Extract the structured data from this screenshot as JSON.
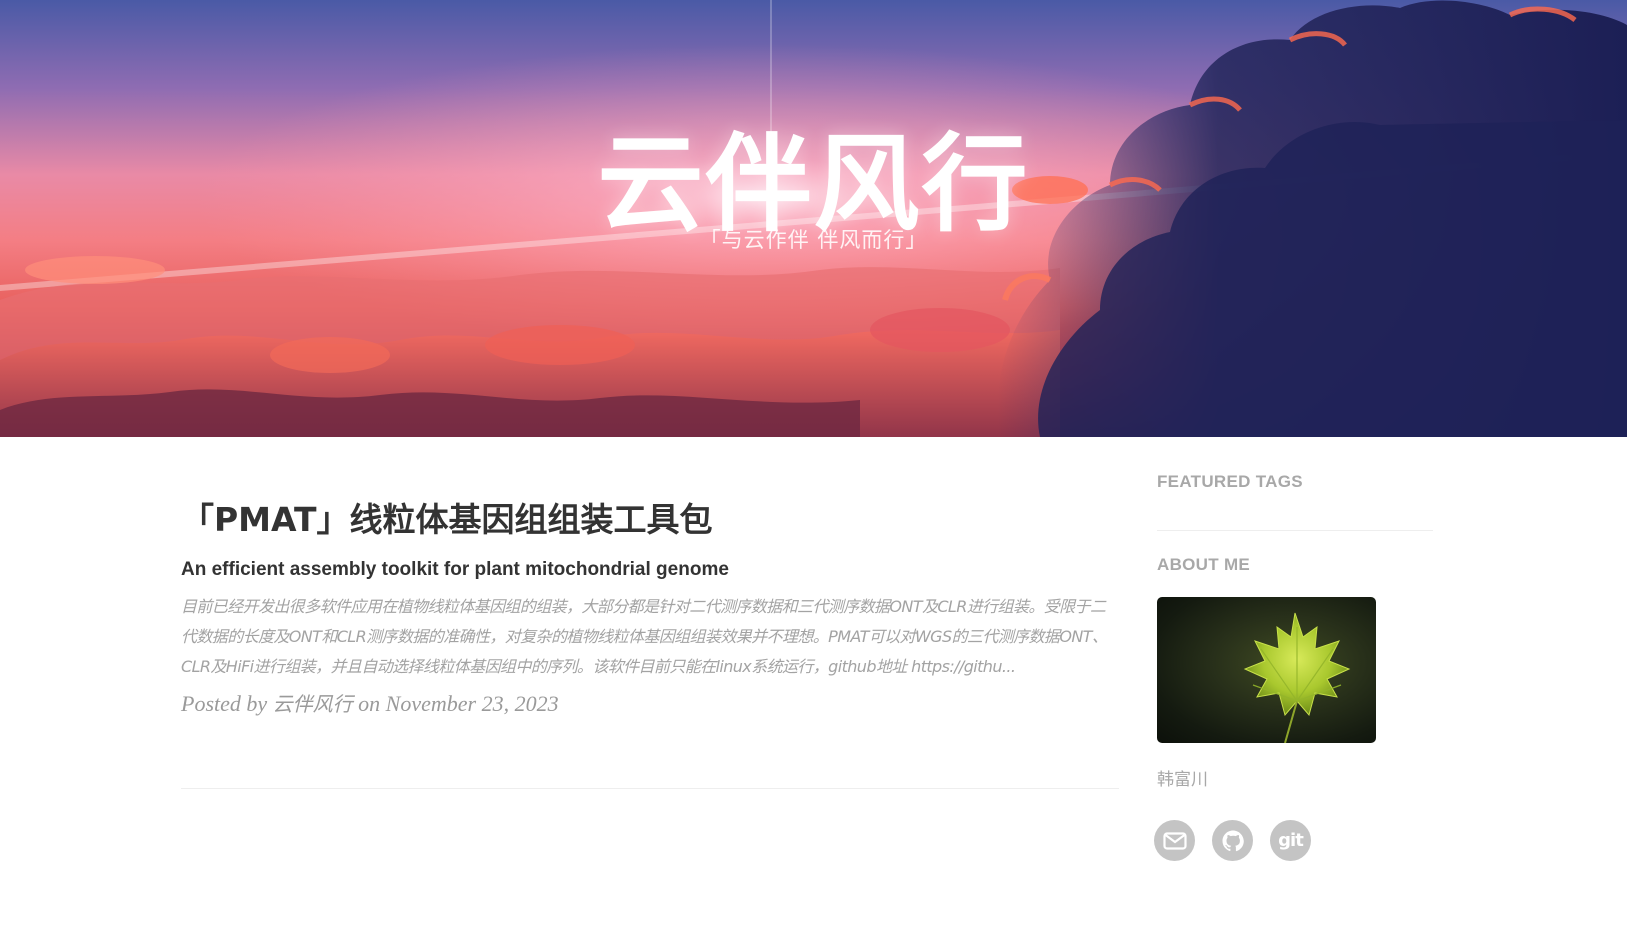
{
  "hero": {
    "title": "云伴风行",
    "subtitle": "「与云作伴 伴风而行」"
  },
  "post": {
    "title": "「PMAT」线粒体基因组组装工具包",
    "subtitle": "An efficient assembly toolkit for plant mitochondrial genome",
    "excerpt": "目前已经开发出很多软件应用在植物线粒体基因组的组装，大部分都是针对二代测序数据和三代测序数据ONT及CLR进行组装。受限于二代数据的长度及ONT和CLR测序数据的准确性，对复杂的植物线粒体基因组组装效果并不理想。PMAT可以对WGS的三代测序数据ONT、CLR及HiFi进行组装，并且自动选择线粒体基因组中的序列。该软件目前只能在linux系统运行，github地址 https://githu...",
    "meta_prefix": "Posted by",
    "author": "云伴风行",
    "meta_on": "on",
    "date": "November 23, 2023"
  },
  "sidebar": {
    "featured_tags_heading": "FEATURED TAGS",
    "about_heading": "ABOUT ME",
    "about_name": "韩富川",
    "social": [
      {
        "icon": "envelope-icon"
      },
      {
        "icon": "github-icon"
      },
      {
        "icon": "git-icon",
        "label": "git"
      }
    ]
  },
  "colors": {
    "heading_text": "#333333",
    "muted_text": "#a8a8a8",
    "social_bg": "#c4c4c4"
  }
}
